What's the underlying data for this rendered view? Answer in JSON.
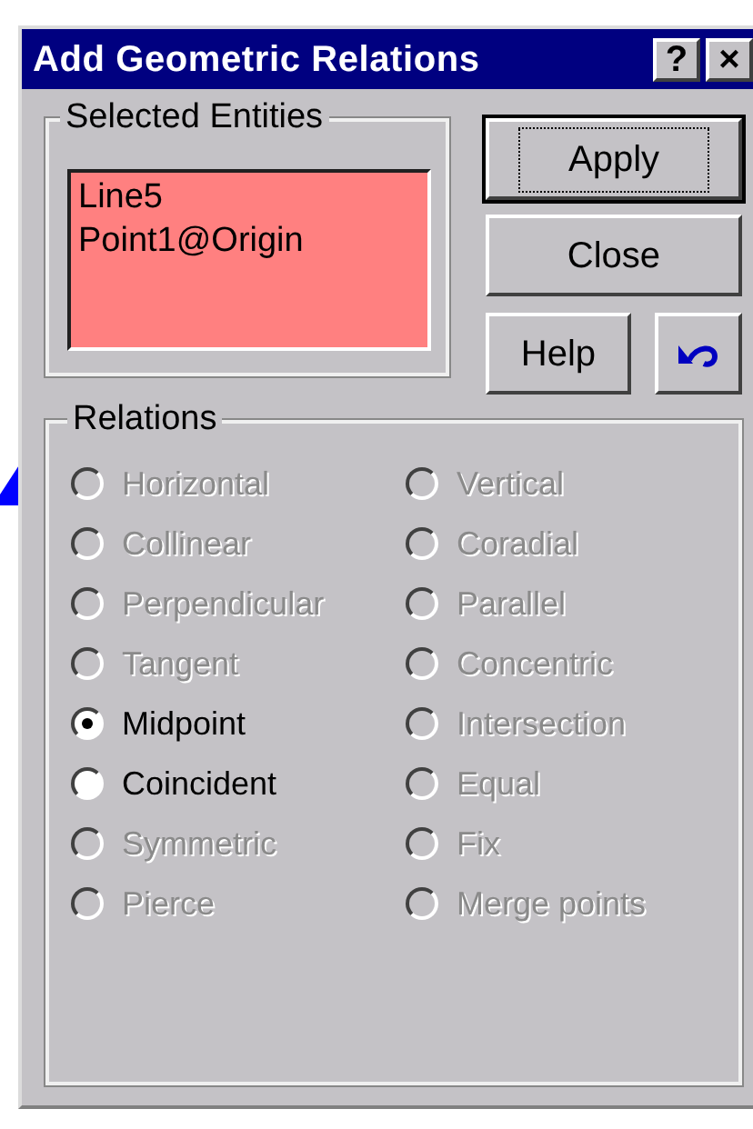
{
  "window": {
    "title": "Add Geometric Relations",
    "title_buttons": [
      "?",
      "×"
    ]
  },
  "selected_entities": {
    "label": "Selected Entities",
    "items": [
      "Line5",
      "Point1@Origin"
    ]
  },
  "buttons": [
    {
      "label": "Apply",
      "default": true
    },
    {
      "label": "Close",
      "default": false
    },
    {
      "label": "Help",
      "default": false
    }
  ],
  "relations": {
    "label": "Relations",
    "options": [
      {
        "label": "Horizontal",
        "selected": false,
        "disabled": true
      },
      {
        "label": "Vertical",
        "selected": false,
        "disabled": true
      },
      {
        "label": "Collinear",
        "selected": false,
        "disabled": true
      },
      {
        "label": "Coradial",
        "selected": false,
        "disabled": true
      },
      {
        "label": "Perpendicular",
        "selected": false,
        "disabled": true
      },
      {
        "label": "Parallel",
        "selected": false,
        "disabled": true
      },
      {
        "label": "Tangent",
        "selected": false,
        "disabled": true
      },
      {
        "label": "Concentric",
        "selected": false,
        "disabled": true
      },
      {
        "label": "Midpoint",
        "selected": true,
        "disabled": false
      },
      {
        "label": "Intersection",
        "selected": false,
        "disabled": true
      },
      {
        "label": "Coincident",
        "selected": false,
        "disabled": false
      },
      {
        "label": "Equal",
        "selected": false,
        "disabled": true
      },
      {
        "label": "Symmetric",
        "selected": false,
        "disabled": true
      },
      {
        "label": "Fix",
        "selected": false,
        "disabled": true
      },
      {
        "label": "Pierce",
        "selected": false,
        "disabled": true
      },
      {
        "label": "Merge points",
        "selected": false,
        "disabled": true
      }
    ]
  }
}
